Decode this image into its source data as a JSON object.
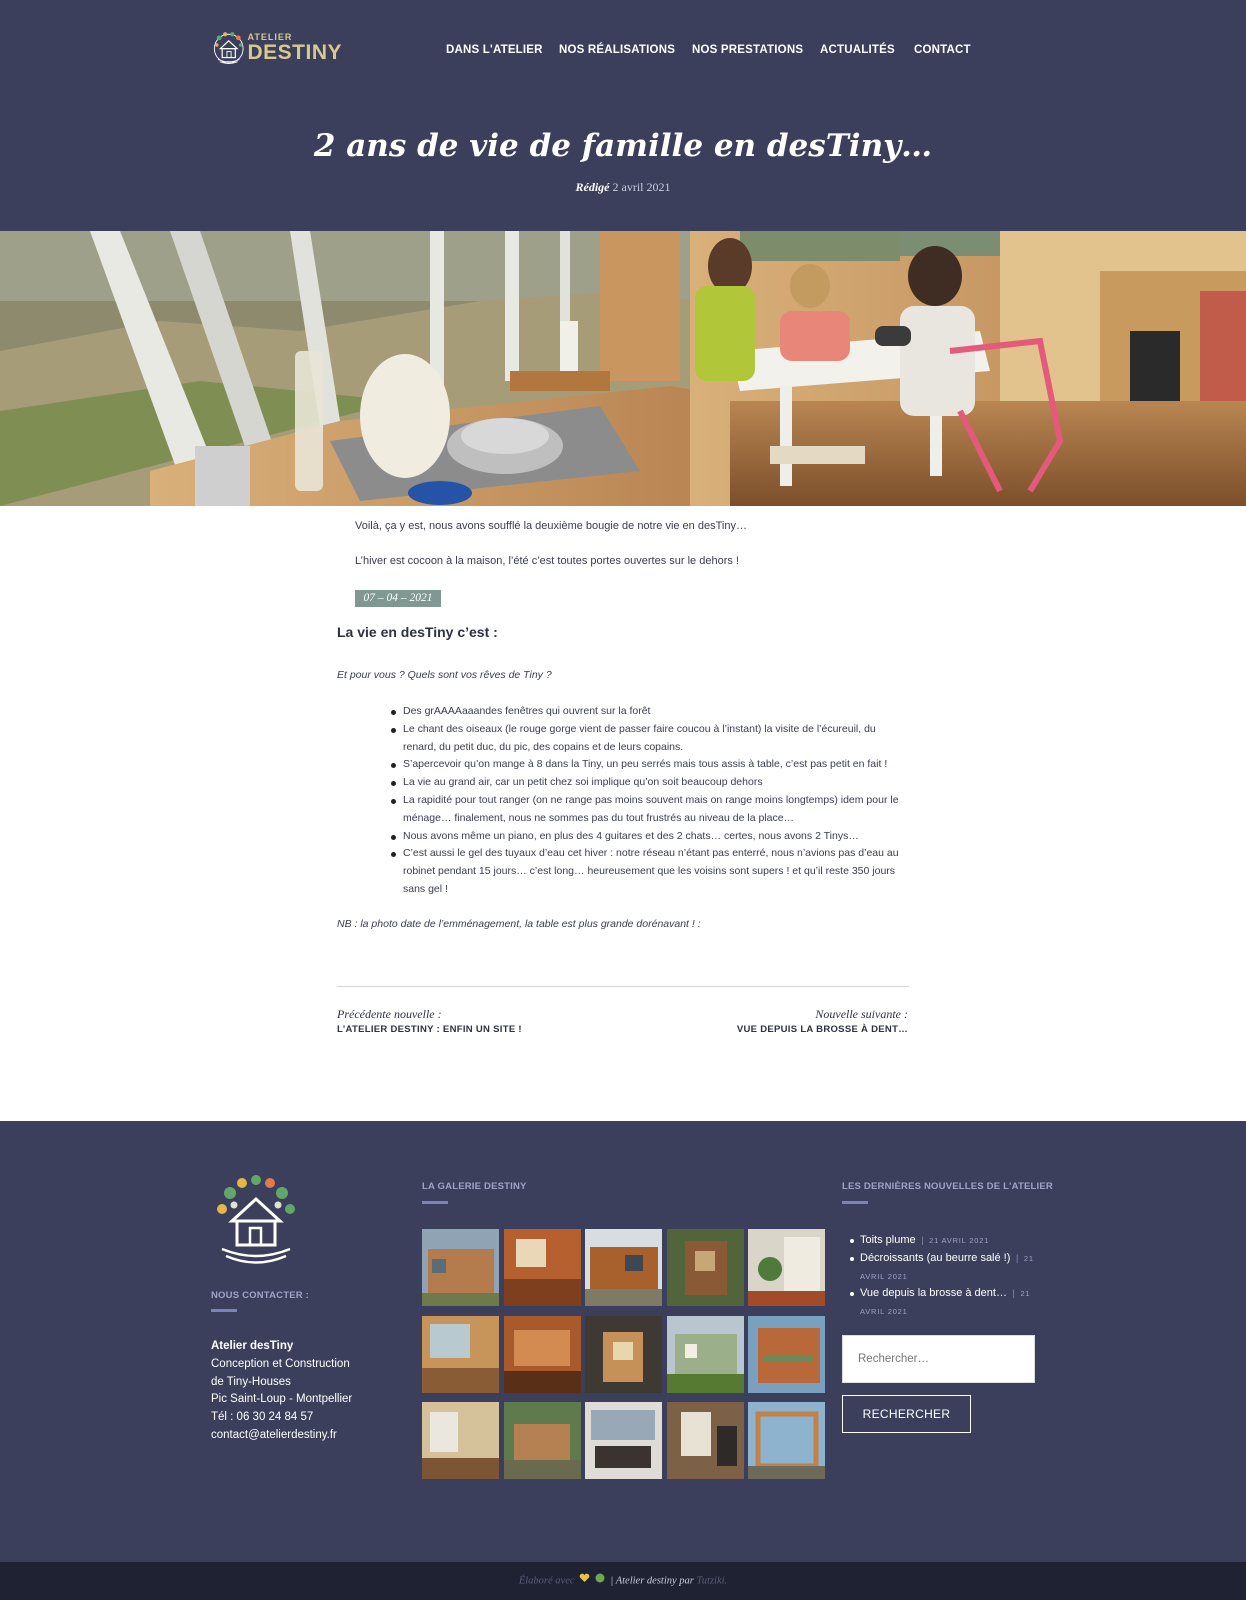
{
  "header": {
    "logo_small": "ATELIER",
    "logo_big": "DESTINY",
    "nav": [
      "DANS L'ATELIER",
      "NOS RÉALISATIONS",
      "NOS PRESTATIONS",
      "ACTUALITÉS",
      "CONTACT"
    ]
  },
  "post": {
    "title": "2 ans de vie de famille en desTiny…",
    "meta_label": "Rédigé",
    "meta_date": "2 avril 2021",
    "intro1": "Voilà, ça y est, nous avons soufflé la deuxième bougie de notre vie en desTiny…",
    "intro2": "L’hiver est cocoon à la maison, l’été c’est toutes portes ouvertes sur le dehors !",
    "date_badge": "07 – 04 – 2021",
    "heading": "La vie en desTiny c’est :",
    "question": "Et pour vous ? Quels sont vos rêves de Tiny ?",
    "items": [
      "Des grAAAAaaandes fenêtres qui ouvrent sur la forêt",
      "Le chant des oiseaux (le rouge gorge vient de passer faire coucou à l’instant) la visite de l’écureuil, du renard, du petit duc, du pic, des copains et de leurs copains.",
      "S’apercevoir qu’on mange à 8 dans la Tiny, un peu serrés mais tous assis à table, c’est pas petit en fait !",
      "La vie au grand air, car un petit chez soi implique qu’on soit beaucoup dehors",
      "La rapidité pour tout ranger (on ne range pas moins souvent mais on range moins longtemps) idem pour le ménage… finalement, nous ne sommes pas du tout frustrés au niveau de la place…",
      "Nous avons même un piano, en plus des 4 guitares et des 2 chats… certes, nous avons 2 Tinys…",
      "C’est aussi le gel des tuyaux d’eau cet hiver : notre réseau n’étant pas enterré, nous n’avions pas d’eau au robinet pendant 15 jours… c’est long… heureusement que les voisins sont supers ! et qu’il reste 350 jours sans gel !"
    ],
    "nb": "NB : la photo date de l’emménagement, la table est plus grande dorénavant ! :"
  },
  "post_nav": {
    "prev_label": "Précédente nouvelle :",
    "prev_title": "L’ATELIER DESTINY : ENFIN UN SITE !",
    "next_label": "Nouvelle suivante :",
    "next_title": "VUE DEPUIS LA BROSSE À DENT…"
  },
  "footer": {
    "contact_heading": "NOUS CONTACTER :",
    "contact_lines": [
      "Atelier desTiny",
      "Conception et Construction",
      "de Tiny-Houses",
      "Pic Saint-Loup - Montpellier",
      "Tél : 06 30 24 84 57",
      "contact@atelierdestiny.fr"
    ],
    "gallery_heading": "LA GALERIE DESTINY",
    "news_heading": "LES DERNIÈRES NOUVELLES DE L'ATELIER",
    "news": [
      {
        "title": "Toits plume",
        "date": "21 AVRIL 2021"
      },
      {
        "title": "Décroissants (au beurre salé !)",
        "date": "21 AVRIL 2021"
      },
      {
        "title": "Vue depuis la brosse à dent…",
        "date": "21 AVRIL 2021"
      }
    ],
    "search_placeholder": "Rechercher…",
    "search_button": "RECHERCHER"
  },
  "bottom": {
    "made_with": "Élaboré avec",
    "middle": "| Atelier destiny par",
    "author": "Tutziki",
    "end": "."
  },
  "colors": {
    "header_bg": "#3b3f5c",
    "badge_bg": "#7f9891",
    "bottom_bar": "#1f2233"
  },
  "icons": [
    "house-logo-icon",
    "heart-icon",
    "leaf-icon"
  ]
}
